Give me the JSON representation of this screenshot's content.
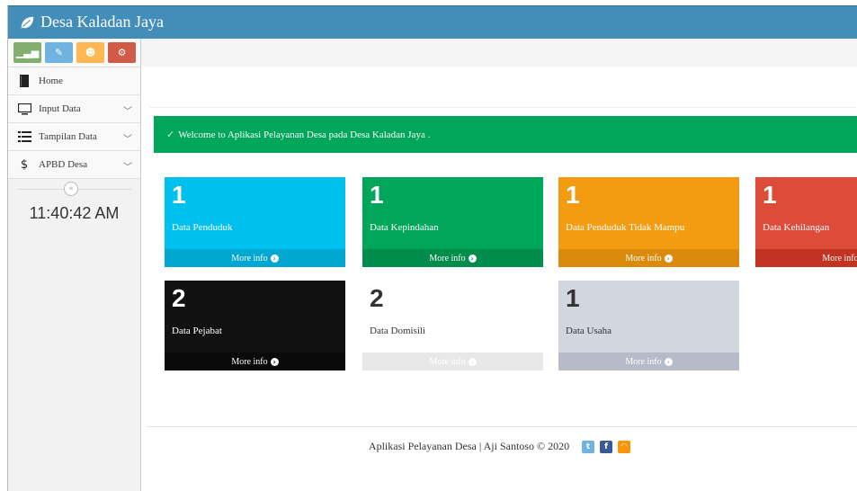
{
  "app": {
    "title": "Desa Kaladan Jaya",
    "icon": "leaf-icon"
  },
  "shortcuts": [
    {
      "name": "stats-shortcut",
      "icon": "chart-icon",
      "color": "#82af6f"
    },
    {
      "name": "edit-shortcut",
      "icon": "pencil-icon",
      "color": "#6fb3e0"
    },
    {
      "name": "users-shortcut",
      "icon": "users-icon",
      "color": "#ffb752"
    },
    {
      "name": "settings-shortcut",
      "icon": "cogs-icon",
      "color": "#d15b47"
    }
  ],
  "sidebar": {
    "items": [
      {
        "label": "Home",
        "icon": "book-icon"
      },
      {
        "label": "Input Data",
        "icon": "desktop-icon"
      },
      {
        "label": "Tampilan Data",
        "icon": "list-icon"
      },
      {
        "label": "APBD Desa",
        "icon": "dollar-icon"
      }
    ],
    "clock": "11:40:42 AM"
  },
  "alert": {
    "text": "Welcome to Aplikasi Pelayanan Desa pada Desa Kaladan Jaya ."
  },
  "stats": [
    {
      "count": "1",
      "label": "Data Penduduk",
      "more": "More info",
      "color": "#00c0ef"
    },
    {
      "count": "1",
      "label": "Data Kepindahan",
      "more": "More info",
      "color": "#00a65a"
    },
    {
      "count": "1",
      "label": "Data Penduduk Tidak Mampu",
      "more": "More info",
      "color": "#f39c12"
    },
    {
      "count": "1",
      "label": "Data Kehilangan",
      "more": "More info",
      "color": "#dd4b39"
    },
    {
      "count": "2",
      "label": "Data Pejabat",
      "more": "More info",
      "color": "#111111"
    },
    {
      "count": "2",
      "label": "Data Domisili",
      "more": "More info",
      "color": "#ffffff"
    },
    {
      "count": "1",
      "label": "Data Usaha",
      "more": "More info",
      "color": "#d2d6de"
    }
  ],
  "footer": {
    "text": "Aplikasi Pelayanan Desa | Aji Santoso © 2020",
    "socials": [
      "twitter-icon",
      "facebook-icon",
      "rss-icon"
    ]
  }
}
